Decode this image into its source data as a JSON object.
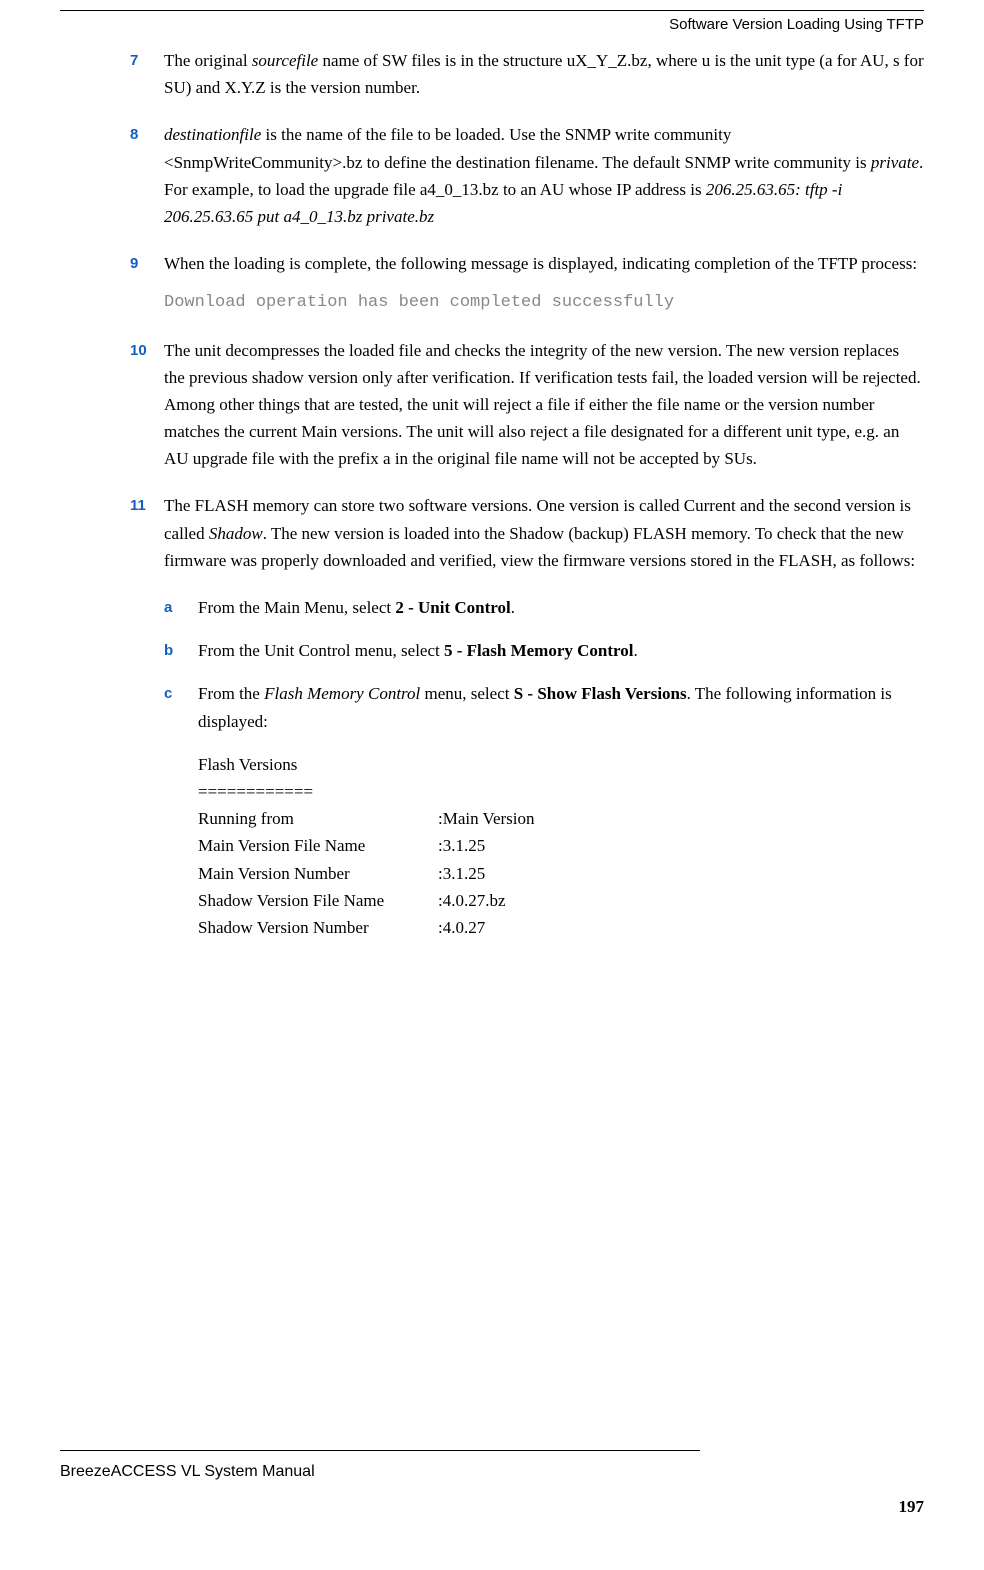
{
  "header": {
    "title": "Software Version Loading Using TFTP"
  },
  "items": [
    {
      "num": "7",
      "segments": [
        {
          "t": "The original "
        },
        {
          "t": "sourcefile",
          "i": true
        },
        {
          "t": " name of SW files is in the structure uX_Y_Z.bz, where u is the unit type (a for AU, s for SU) and X.Y.Z is the version number."
        }
      ]
    },
    {
      "num": "8",
      "segments": [
        {
          "t": " destinationfile",
          "i": true
        },
        {
          "t": " is the name of the file to be loaded. Use the SNMP write community <SnmpWriteCommunity>.bz to define the destination filename. The default SNMP write community is "
        },
        {
          "t": "private",
          "i": true
        },
        {
          "t": ". For example, to load the upgrade file a4_0_13.bz to an AU whose IP address is "
        },
        {
          "t": "206.25.63.65: tftp -i 206.25.63.65 put a4_0_13.bz private.bz",
          "i": true
        }
      ]
    },
    {
      "num": "9",
      "segments": [
        {
          "t": "When the loading is complete, the following message is displayed, indicating completion of the TFTP process:"
        }
      ],
      "code": "Download operation has been completed successfully"
    },
    {
      "num": "10",
      "segments": [
        {
          "t": "The unit decompresses the loaded file and checks the integrity of the new version. The new version replaces the previous shadow version only after verification. If verification tests fail, the loaded version will be rejected. Among other things that are tested, the unit will reject a file if either the file name or the version number matches the current Main versions. The unit will also reject a file designated for a different unit type, e.g. an AU upgrade file with the prefix a in the original file name will not be accepted by SUs."
        }
      ]
    },
    {
      "num": "11",
      "segments": [
        {
          "t": "The FLASH memory can store two software versions. One version is called Current and the second version is called "
        },
        {
          "t": "Shadow",
          "i": true
        },
        {
          "t": ". The new version is loaded into the Shadow (backup) FLASH memory. To check that the new firmware was properly downloaded and verified, view the firmware versions stored in the FLASH, as follows:"
        }
      ],
      "subitems": [
        {
          "letter": "a",
          "segments": [
            {
              "t": "From the Main Menu, select "
            },
            {
              "t": "2 - Unit Control",
              "b": true
            },
            {
              "t": "."
            }
          ]
        },
        {
          "letter": "b",
          "segments": [
            {
              "t": "From the Unit Control menu, select "
            },
            {
              "t": "5 - Flash Memory Control",
              "b": true
            },
            {
              "t": "."
            }
          ]
        },
        {
          "letter": "c",
          "segments": [
            {
              "t": "From the "
            },
            {
              "t": "Flash Memory Control",
              "i": true
            },
            {
              "t": " menu, select "
            },
            {
              "t": "S - Show Flash Versions",
              "b": true
            },
            {
              "t": ". The following information is displayed:"
            }
          ]
        }
      ],
      "flash": {
        "heading": "Flash Versions",
        "underline": "============",
        "rows": [
          {
            "label": "Running from",
            "value": ":Main Version"
          },
          {
            "label": "Main Version File Name",
            "value": ":3.1.25"
          },
          {
            "label": "Main Version Number",
            "value": ":3.1.25"
          },
          {
            "label": "Shadow Version File Name",
            "value": ":4.0.27.bz"
          },
          {
            "label": "Shadow Version Number",
            "value": ":4.0.27"
          }
        ]
      }
    }
  ],
  "footer": {
    "manual": "BreezeACCESS VL System Manual",
    "page": "197"
  }
}
